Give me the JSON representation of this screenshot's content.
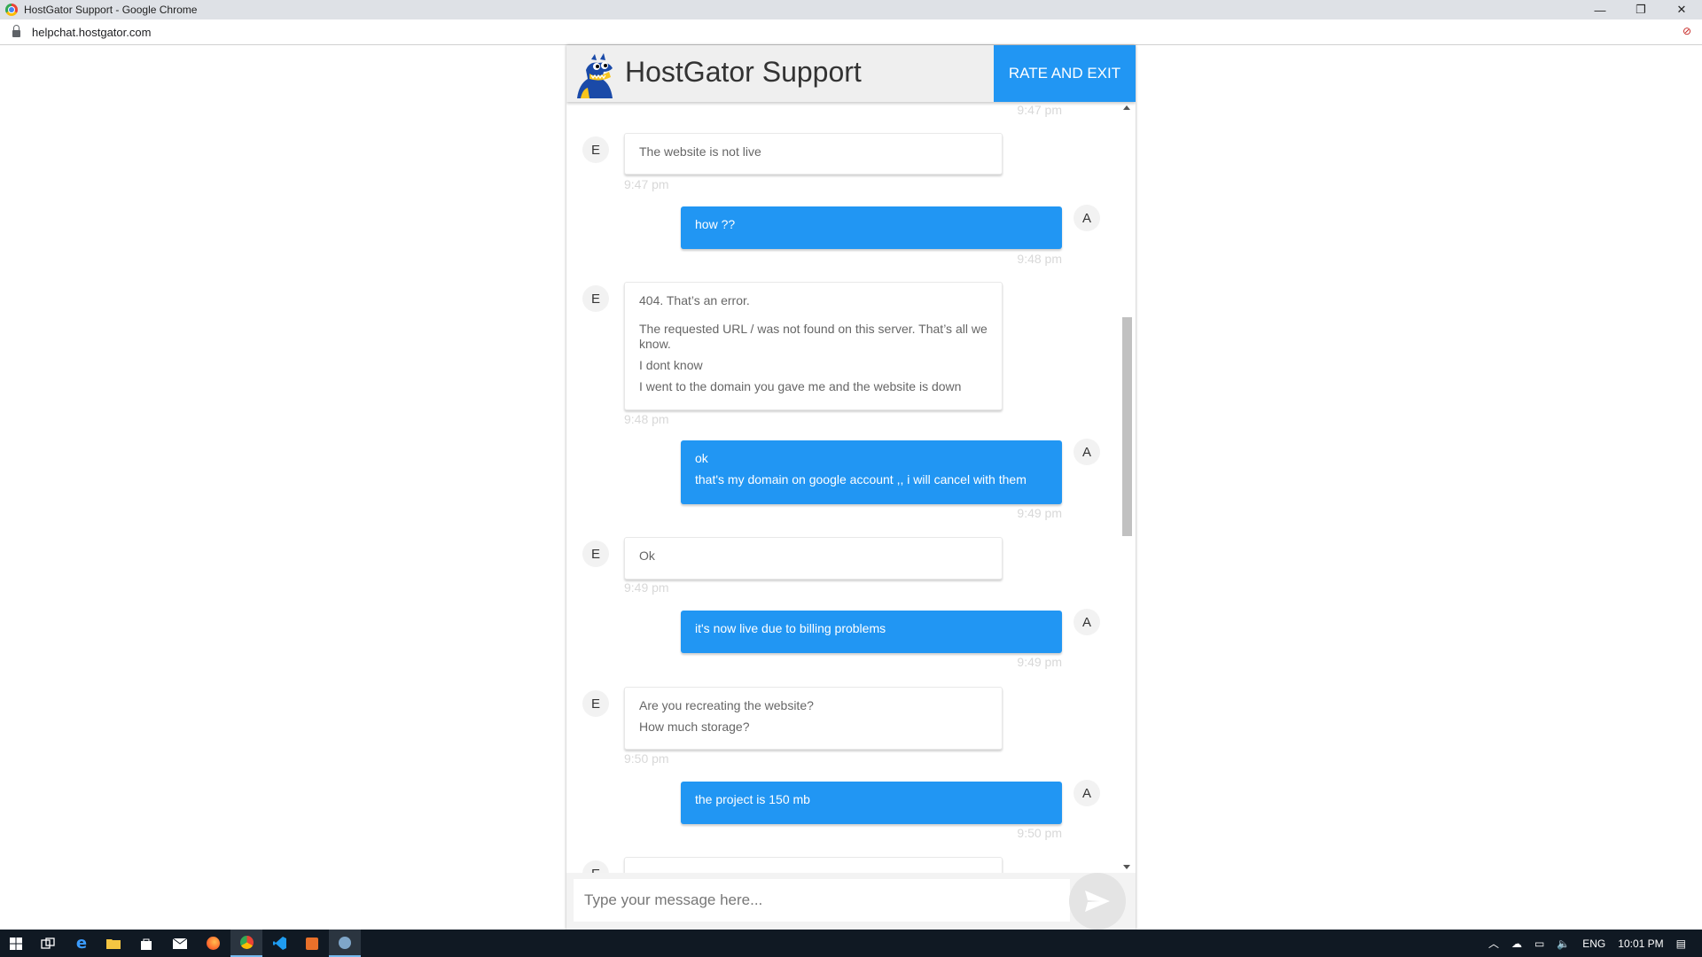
{
  "browser": {
    "window_title": "HostGator Support - Google Chrome",
    "url": "helpchat.hostgator.com",
    "controls": {
      "minimize": "—",
      "restore": "❐",
      "close": "✕"
    }
  },
  "chat": {
    "title": "HostGator Support",
    "rate_exit_label": "RATE AND EXIT",
    "accent_color": "#2196f3",
    "top_partial_time": "9:47 pm",
    "messages": [
      {
        "from": "E",
        "lines": [
          "The website is not live"
        ],
        "time": "9:47 pm"
      },
      {
        "from": "A",
        "lines": [
          "how ??"
        ],
        "time": "9:48 pm"
      },
      {
        "from": "E",
        "lines": [
          "404. That’s an error.",
          "The requested URL / was not found on this server. That’s all we know.",
          "I dont know",
          "I went to the domain you gave me and the website is down"
        ],
        "time": "9:48 pm"
      },
      {
        "from": "A",
        "lines": [
          "ok",
          "that's my domain on google account ,, i will cancel with them"
        ],
        "time": "9:49 pm"
      },
      {
        "from": "E",
        "lines": [
          "Ok"
        ],
        "time": "9:49 pm"
      },
      {
        "from": "A",
        "lines": [
          "it's now live due to billing problems"
        ],
        "time": "9:49 pm"
      },
      {
        "from": "E",
        "lines": [
          "Are you recreating the website?",
          "How much storage?"
        ],
        "time": "9:50 pm"
      },
      {
        "from": "A",
        "lines": [
          "the project is 150 mb"
        ],
        "time": "9:50 pm"
      },
      {
        "from": "E",
        "lines": [
          ""
        ],
        "time": ""
      }
    ],
    "input_placeholder": "Type your message here..."
  },
  "taskbar": {
    "language": "ENG",
    "clock": "10:01 PM"
  }
}
